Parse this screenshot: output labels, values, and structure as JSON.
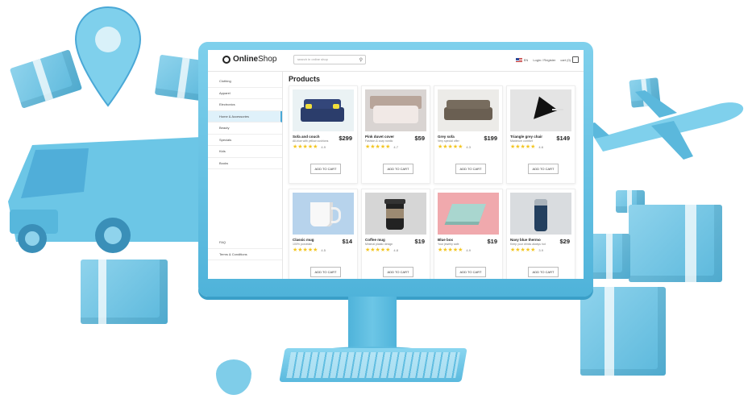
{
  "brand": {
    "name_bold": "Online",
    "name_regular": "Shop"
  },
  "search": {
    "placeholder": "search in online shop"
  },
  "header": {
    "lang": "EN",
    "auth": "Login / Register",
    "cart": "cart (0)"
  },
  "sidebar": {
    "items": [
      {
        "label": "Clothing"
      },
      {
        "label": "Apparel"
      },
      {
        "label": "Electronics"
      },
      {
        "label": "Home & Accessories",
        "active": true
      },
      {
        "label": "Beauty"
      },
      {
        "label": "Specials"
      },
      {
        "label": "Kids"
      },
      {
        "label": "Books"
      }
    ],
    "bottom": [
      {
        "label": "FAQ"
      },
      {
        "label": "Terms & Conditions"
      }
    ]
  },
  "page_title": "Products",
  "products": [
    {
      "name": "Sofa and couch",
      "desc": "All-blue with yellow cushions",
      "price": "$299",
      "rating": "4.9",
      "button": "ADD TO CART"
    },
    {
      "name": "Pink duvet cover",
      "desc": "Fashion & cozy nordic",
      "price": "$59",
      "rating": "4.7",
      "button": "ADD TO CART"
    },
    {
      "name": "Grey sofa",
      "desc": "Very special offer",
      "price": "$199",
      "rating": "4.3",
      "button": "ADD TO CART"
    },
    {
      "name": "Triangle grey chair",
      "desc": "Maximum comfort",
      "price": "$149",
      "rating": "4.6",
      "button": "ADD TO CART"
    },
    {
      "name": "Classic mug",
      "desc": "100% porcelain",
      "price": "$14",
      "rating": "4.5",
      "button": "ADD TO CART"
    },
    {
      "name": "Coffee mug",
      "desc": "Minimal plastic design",
      "price": "$19",
      "rating": "4.8",
      "button": "ADD TO CART"
    },
    {
      "name": "Blue box",
      "desc": "Your jewelry safe",
      "price": "$19",
      "rating": "4.9",
      "button": "ADD TO CART"
    },
    {
      "name": "Navy blue thermo",
      "desc": "Keep your drinks always hot",
      "price": "$29",
      "rating": "3.9",
      "button": "ADD TO CART"
    }
  ],
  "colors": {
    "accent": "#4fb3da",
    "star": "#f3c622"
  }
}
